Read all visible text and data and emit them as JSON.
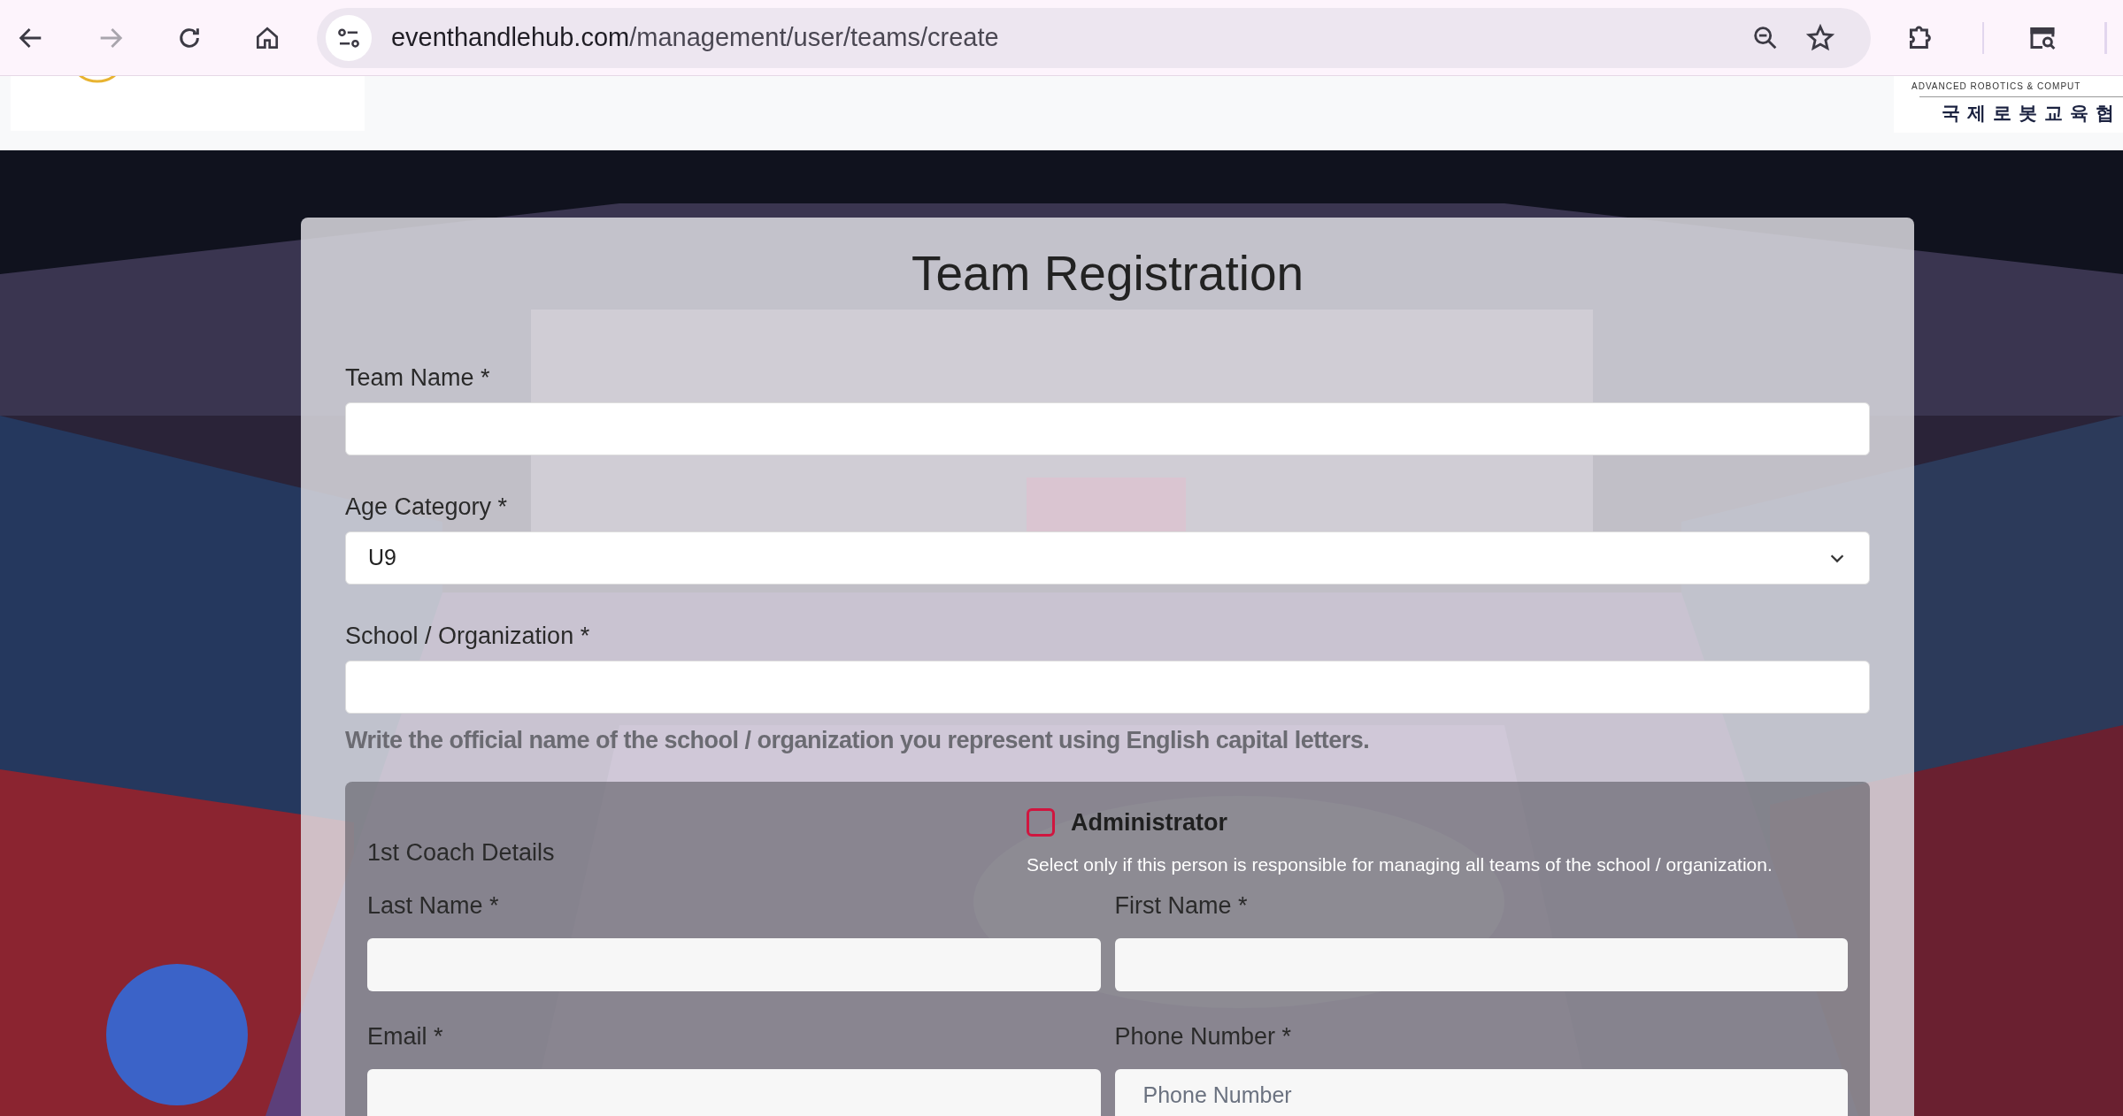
{
  "browser": {
    "url_domain": "eventhandlehub.com",
    "url_path": "/management/user/teams/create"
  },
  "header": {
    "right_logo": {
      "line1": "ADVANCED ROBOTICS & COMPUT",
      "line2": "국제로봇교육협"
    }
  },
  "form": {
    "title": "Team Registration",
    "fields": [
      {
        "kind": "text",
        "label": "Team Name *"
      },
      {
        "kind": "select",
        "label": "Age Category *",
        "value": "U9"
      },
      {
        "kind": "text",
        "label": "School / Organization *",
        "hint": "Write the official name of the school / organization you represent using English capital letters."
      }
    ],
    "coach": {
      "title": "1st Coach Details",
      "administrator": {
        "label": "Administrator",
        "checked": false,
        "note": "Select only if this person is responsible for managing all teams of the school / organization."
      },
      "fields": [
        {
          "label": "Last Name *"
        },
        {
          "label": "First Name *"
        },
        {
          "label": "Email *"
        },
        {
          "label": "Phone Number *",
          "placeholder": "Phone Number"
        }
      ]
    }
  }
}
